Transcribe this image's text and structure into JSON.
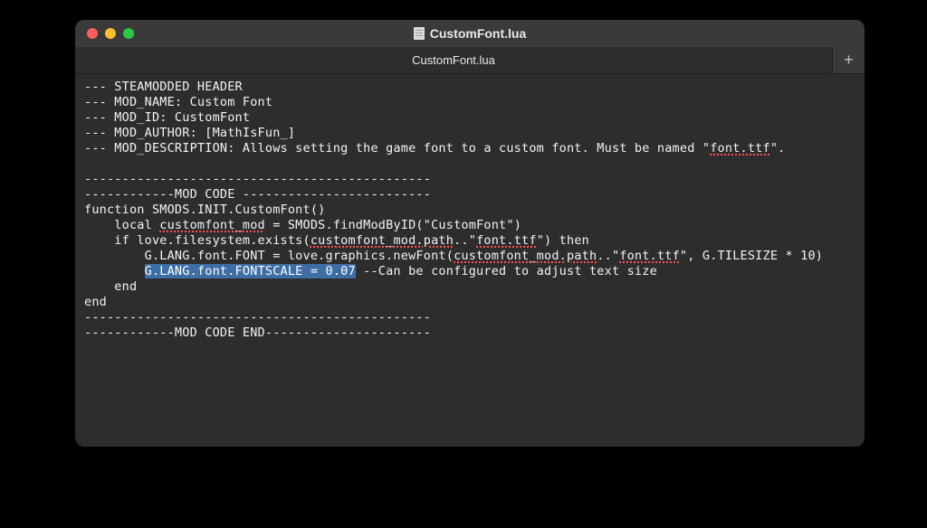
{
  "window": {
    "title": "CustomFont.lua",
    "tab_label": "CustomFont.lua",
    "new_tab_glyph": "+"
  },
  "code": {
    "l1": "--- STEAMODDED HEADER",
    "l2": "--- MOD_NAME: Custom Font",
    "l3": "--- MOD_ID: CustomFont",
    "l4": "--- MOD_AUTHOR: [MathIsFun_]",
    "l5a": "--- MOD_DESCRIPTION: Allows setting the game font to a custom font. Must be named \"",
    "l5_ttf": "font.ttf",
    "l5b": "\".",
    "l7": "----------------------------------------------",
    "l8": "------------MOD CODE -------------------------",
    "l9": "function SMODS.INIT.CustomFont()",
    "l10a": "    local ",
    "l10_lv": "customfont_mod",
    "l10b": " = SMODS.findModByID(\"CustomFont\")",
    "l11a": "    if love.filesystem.exists(",
    "l11_p": "customfont_mod.path",
    "l11b": "..\"",
    "l11_ttf": "font.ttf",
    "l11c": "\") then",
    "l12a": "        G.LANG.font.FONT = love.graphics.newFont(",
    "l12_p": "customfont_mod.path",
    "l12b": "..\"",
    "l12_ttf": "font.ttf",
    "l12c": "\", G.TILESIZE * 10)",
    "l13_indent": "        ",
    "l13_sel": "G.LANG.font.FONTSCALE = 0.07",
    "l13b": " --Can be configured to adjust text size",
    "l14": "    end",
    "l15": "end",
    "l16": "----------------------------------------------",
    "l17": "------------MOD CODE END----------------------"
  }
}
